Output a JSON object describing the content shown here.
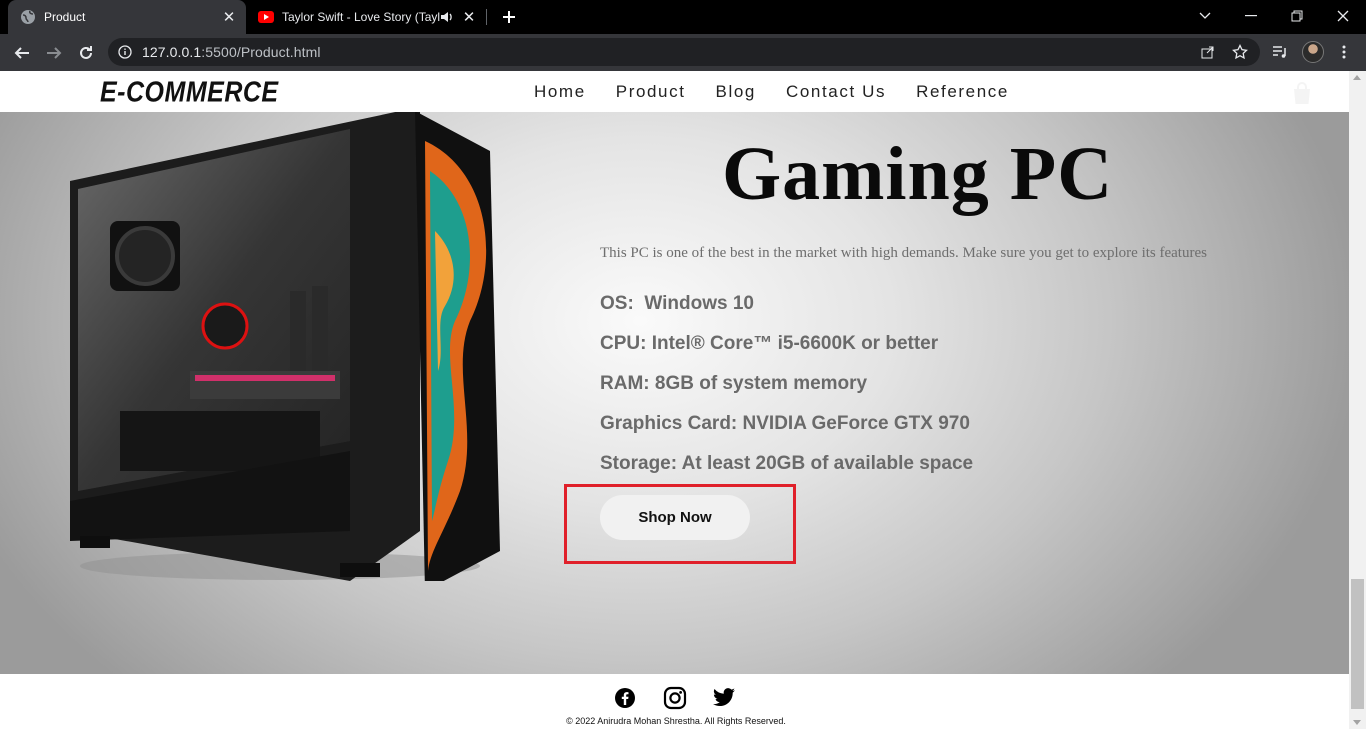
{
  "browser": {
    "tabs": [
      {
        "title": "Product",
        "icon": "globe-icon",
        "active": true
      },
      {
        "title": "Taylor Swift - Love Story (Taylor's Version)",
        "icon": "youtube-icon",
        "active": false,
        "audio": true
      }
    ],
    "url_host": "127.0.0.1",
    "url_path": ":5500/Product.html"
  },
  "header": {
    "logo": "E-COMMERCE",
    "nav": [
      "Home",
      "Product",
      "Blog",
      "Contact Us",
      "Reference"
    ]
  },
  "product": {
    "title": "Gaming PC",
    "description": "This PC is one of the best in the market with high demands. Make sure you get to explore its features",
    "specs": [
      "OS:  Windows 10",
      "CPU: Intel® Core™ i5-6600K or better",
      "RAM: 8GB of system memory",
      "Graphics Card: NVIDIA GeForce GTX 970",
      "Storage: At least 20GB of available space"
    ],
    "button": "Shop Now"
  },
  "footer": {
    "social": [
      "facebook-icon",
      "instagram-icon",
      "twitter-icon"
    ],
    "copyright": "© 2022 Anirudra Mohan Shrestha. All Rights Reserved."
  },
  "colors": {
    "highlight": "#e0202a",
    "chrome_dark": "#35363a",
    "youtube_red": "#ff0000"
  }
}
